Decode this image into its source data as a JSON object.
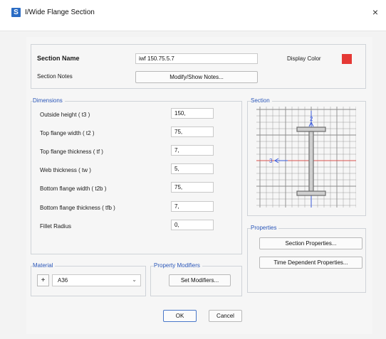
{
  "window": {
    "app_icon": "S",
    "title": "I/Wide Flange Section",
    "close": "×"
  },
  "header": {
    "section_name_label": "Section Name",
    "section_name_value": "iwf 150.75.5.7",
    "display_color_label": "Display Color",
    "display_color": "#e53935",
    "section_notes_label": "Section Notes",
    "notes_button": "Modify/Show Notes..."
  },
  "dimensions": {
    "title": "Dimensions",
    "rows": [
      {
        "label": "Outside height  ( t3 )",
        "value": "150,"
      },
      {
        "label": "Top flange width  ( t2 )",
        "value": "75,"
      },
      {
        "label": "Top flange thickness  ( tf )",
        "value": "7,"
      },
      {
        "label": "Web thickness  ( tw )",
        "value": "5,"
      },
      {
        "label": "Bottom flange width  ( t2b )",
        "value": "75,"
      },
      {
        "label": "Bottom flange thickness  ( tfb )",
        "value": "7,"
      },
      {
        "label": "Fillet Radius",
        "value": "0,"
      }
    ]
  },
  "section": {
    "title": "Section",
    "axis2_label": "2",
    "axis3_label": "3",
    "grid_color": "#8a8a8a",
    "axis_color": "#d9534f",
    "axis2_color": "#3b5bdb",
    "shape_color": "#6e6e6e"
  },
  "properties": {
    "title": "Properties",
    "section_properties_button": "Section Properties...",
    "time_dependent_button": "Time Dependent Properties..."
  },
  "material": {
    "title": "Material",
    "plus_button": "+",
    "selected": "A36"
  },
  "modifiers": {
    "title": "Property Modifiers",
    "button": "Set Modifiers..."
  },
  "footer": {
    "ok": "OK",
    "cancel": "Cancel"
  },
  "colors": {
    "group_title": "#2a56b8",
    "ok_border": "#4a78c9"
  }
}
